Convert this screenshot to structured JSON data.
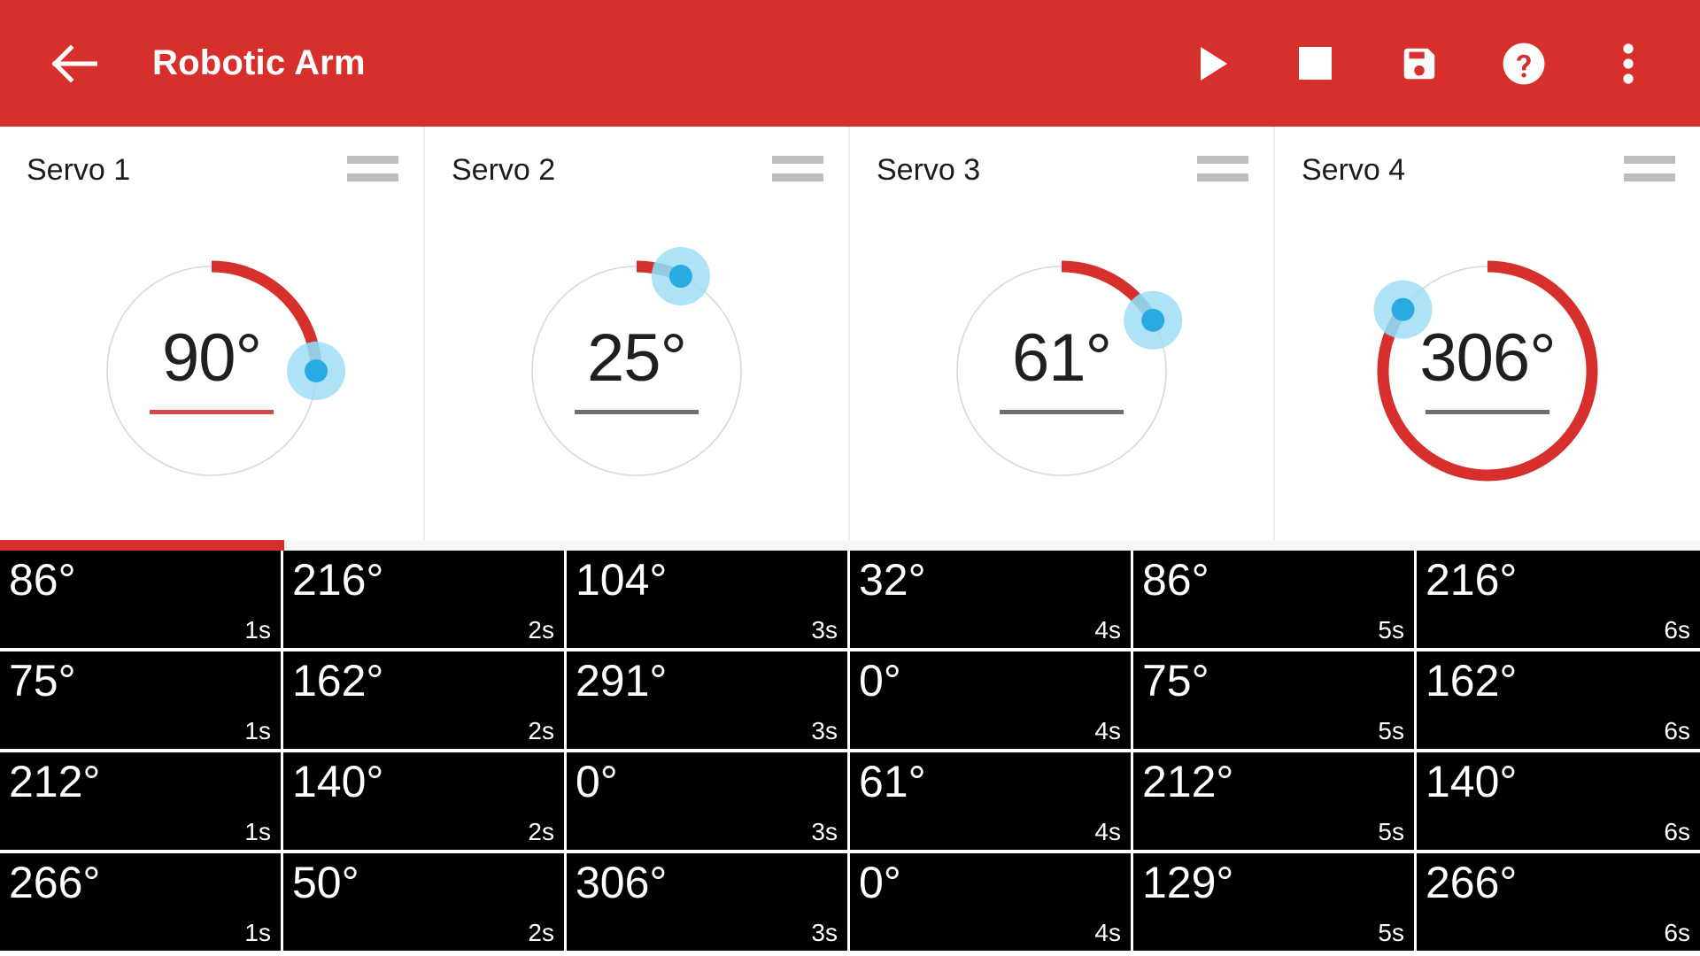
{
  "appbar": {
    "back_label": "back-arrow",
    "title": "Robotic Arm",
    "actions": [
      {
        "name": "play-button",
        "icon": "play-icon",
        "label": "Play"
      },
      {
        "name": "stop-button",
        "icon": "stop-icon",
        "label": "Stop"
      },
      {
        "name": "save-button",
        "icon": "save-floppy-icon",
        "label": "Save"
      },
      {
        "name": "help-button",
        "icon": "help-question-icon",
        "label": "Help"
      },
      {
        "name": "overflow-menu-button",
        "icon": "more-vertical-icon",
        "label": "More options"
      }
    ],
    "bg_color": "#d7302c",
    "fg_color": "#ffffff"
  },
  "servos": [
    {
      "title": "Servo 1",
      "value_text": "90°",
      "angle": 90,
      "arc_color": "#d7302c",
      "rule_color": "#cf4a4a",
      "handle_color": "#29abe2",
      "handle_halo": "#9bdcf5",
      "drag_handle": "drag-handle-icon"
    },
    {
      "title": "Servo 2",
      "value_text": "25°",
      "angle": 25,
      "arc_color": "#d7302c",
      "rule_color": "#6e6e6e",
      "handle_color": "#29abe2",
      "handle_halo": "#9bdcf5",
      "drag_handle": "drag-handle-icon"
    },
    {
      "title": "Servo 3",
      "value_text": "61°",
      "angle": 61,
      "arc_color": "#d7302c",
      "rule_color": "#6e6e6e",
      "handle_color": "#29abe2",
      "handle_halo": "#9bdcf5",
      "drag_handle": "drag-handle-icon"
    },
    {
      "title": "Servo 4",
      "value_text": "306°",
      "angle": 306,
      "arc_color": "#d7302c",
      "rule_color": "#6e6e6e",
      "handle_color": "#29abe2",
      "handle_halo": "#9bdcf5",
      "drag_handle": "drag-handle-icon"
    }
  ],
  "progress": {
    "percent": 16.7,
    "fill_color": "#d7302c",
    "track_color": "#f7f7f7"
  },
  "timeline": {
    "columns": [
      "1s",
      "2s",
      "3s",
      "4s",
      "5s",
      "6s"
    ],
    "rows": [
      {
        "values": [
          "86°",
          "216°",
          "104°",
          "32°",
          "86°",
          "216°"
        ]
      },
      {
        "values": [
          "75°",
          "162°",
          "291°",
          "0°",
          "75°",
          "162°"
        ]
      },
      {
        "values": [
          "212°",
          "140°",
          "0°",
          "61°",
          "212°",
          "140°"
        ]
      },
      {
        "values": [
          "266°",
          "50°",
          "306°",
          "0°",
          "129°",
          "266°"
        ]
      }
    ],
    "cell_bg": "#000000",
    "cell_fg": "#ffffff"
  }
}
